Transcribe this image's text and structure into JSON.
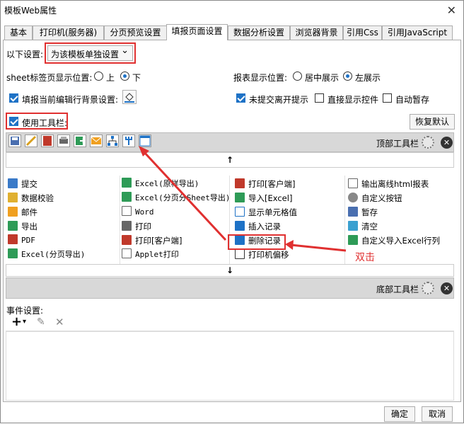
{
  "window": {
    "title": "模板Web属性",
    "close": "✕"
  },
  "tabs": [
    {
      "label": "基本"
    },
    {
      "label": "打印机(服务器)"
    },
    {
      "label": "分页预览设置"
    },
    {
      "label": "填报页面设置"
    },
    {
      "label": "数据分析设置"
    },
    {
      "label": "浏览器背景"
    },
    {
      "label": "引用Css"
    },
    {
      "label": "引用JavaScript"
    }
  ],
  "settings": {
    "label": "以下设置:",
    "select_value": "为该模板单独设置",
    "arrow": "⌄"
  },
  "sheet_tab": {
    "label": "sheet标签页显示位置:",
    "opt1": "上",
    "opt2": "下"
  },
  "report_display": {
    "label": "报表显示位置:",
    "opt1": "居中展示",
    "opt2": "左展示"
  },
  "fill_bg": {
    "label": "填报当前编辑行背景设置:"
  },
  "unsubmitted": {
    "label": "未提交离开提示"
  },
  "direct_show": {
    "label": "直接显示控件"
  },
  "auto_save": {
    "label": "自动暂存"
  },
  "use_toolbar": {
    "label": "使用工具栏:"
  },
  "restore_btn": "恢复默认",
  "top_bar_label": "顶部工具栏",
  "bottom_bar_label": "底部工具栏",
  "up_arrow": "↑",
  "down_arrow": "↓",
  "items": [
    [
      "提交",
      "Excel(原样导出)",
      "打印[客户端]",
      "输出离线html报表"
    ],
    [
      "数据校验",
      "Excel(分页分Sheet导出)",
      "导入[Excel]",
      "自定义按钮"
    ],
    [
      "邮件",
      "Word",
      "显示单元格值",
      "暂存"
    ],
    [
      "导出",
      "打印",
      "插入记录",
      "清空"
    ],
    [
      "PDF",
      "打印[客户端]",
      "删除记录",
      "自定义导入Excel行列"
    ],
    [
      "Excel(分页导出)",
      "Applet打印",
      "打印机偏移",
      ""
    ]
  ],
  "annotation": "双击",
  "event": {
    "label": "事件设置:",
    "add": "+",
    "arrow": "▾",
    "edit": "✎",
    "delete": "✕"
  },
  "footer": {
    "ok": "确定",
    "cancel": "取消"
  },
  "colors": {
    "red": "#e03030",
    "blue": "#1e72c6",
    "green": "#2e9b57"
  }
}
